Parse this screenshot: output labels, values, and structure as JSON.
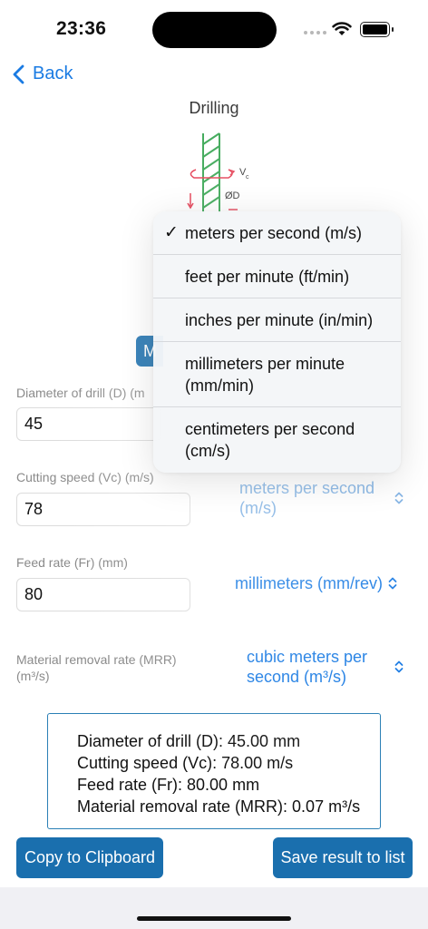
{
  "status": {
    "time": "23:36"
  },
  "nav": {
    "back_label": "Back"
  },
  "diagram": {
    "title": "Drilling",
    "label_vc": "Vc",
    "label_vc_main": "V",
    "label_vc_sub": "c",
    "label_diameter": "ØD"
  },
  "unit_button": {
    "label": "M"
  },
  "fields": {
    "diameter": {
      "label": "Diameter of drill (D) (m",
      "value": "45"
    },
    "cutting_speed": {
      "label": "Cutting speed (Vc) (m/s)",
      "value": "78",
      "unit": "meters per second (m/s)",
      "unit_line1": "meters per second",
      "unit_line2": "(m/s)"
    },
    "feed_rate": {
      "label": "Feed rate (Fr) (mm)",
      "value": "80",
      "unit": "millimeters (mm/rev)"
    },
    "mrr": {
      "label_line1": "Material removal rate (MRR)",
      "label_line2": "(m³/s)",
      "unit_line1": "cubic meters per",
      "unit_line2": "second (m³/s)"
    }
  },
  "result": {
    "lines": [
      "Diameter of drill (D): 45.00 mm",
      "Cutting speed (Vc): 78.00 m/s",
      "Feed rate (Fr): 80.00 mm",
      "Material removal rate (MRR): 0.07 m³/s"
    ]
  },
  "actions": {
    "copy_label": "Copy to Clipboard",
    "save_label": "Save result to list"
  },
  "menu": {
    "selected": "meters per second (m/s)",
    "items": [
      {
        "line1": "meters per second (m/s)",
        "line2": ""
      },
      {
        "line1": "feet per minute (ft/min)",
        "line2": ""
      },
      {
        "line1": "inches per minute (in/min)",
        "line2": ""
      },
      {
        "line1": "millimeters per minute",
        "line2": "(mm/min)"
      },
      {
        "line1": "centimeters per second",
        "line2": "(cm/s)"
      }
    ]
  },
  "colors": {
    "accent": "#1a7be3",
    "button": "#1a6fae",
    "drill_green": "#1e9a3c",
    "arrow_red": "#e0223a"
  }
}
